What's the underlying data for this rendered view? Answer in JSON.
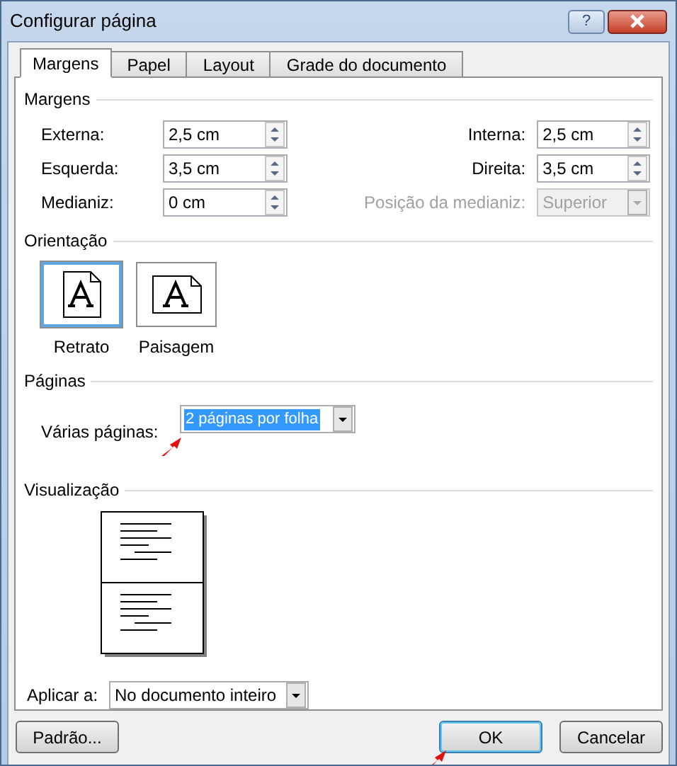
{
  "window": {
    "title": "Configurar página",
    "help": "?"
  },
  "tabs": [
    {
      "label": "Margens",
      "selected": true
    },
    {
      "label": "Papel",
      "selected": false
    },
    {
      "label": "Layout",
      "selected": false
    },
    {
      "label": "Grade do documento",
      "selected": false
    }
  ],
  "margins": {
    "heading": "Margens",
    "fields": [
      {
        "label": "Externa:",
        "value": "2,5 cm",
        "kind": "spin",
        "disabled": false
      },
      {
        "label": "Interna:",
        "value": "2,5 cm",
        "kind": "spin",
        "disabled": false
      },
      {
        "label": "Esquerda:",
        "value": "3,5 cm",
        "kind": "spin",
        "disabled": false
      },
      {
        "label": "Direita:",
        "value": "3,5 cm",
        "kind": "spin",
        "disabled": false
      },
      {
        "label": "Medianiz:",
        "value": "0 cm",
        "kind": "spin",
        "disabled": false
      },
      {
        "label": "Posição da medianiz:",
        "value": "Superior",
        "kind": "dropdown",
        "disabled": true
      }
    ]
  },
  "orientation": {
    "heading": "Orientação",
    "options": [
      {
        "label": "Retrato",
        "kind": "portrait",
        "selected": true
      },
      {
        "label": "Paisagem",
        "kind": "landscape",
        "selected": false
      }
    ]
  },
  "pages": {
    "heading": "Páginas",
    "label": "Várias páginas:",
    "value": "2 páginas por folha",
    "focused": true
  },
  "preview": {
    "heading": "Visualização"
  },
  "apply_to": {
    "label": "Aplicar a:",
    "value": "No documento inteiro"
  },
  "buttons": [
    {
      "label": "Padrão...",
      "default": false
    },
    {
      "label": "OK",
      "default": true
    },
    {
      "label": "Cancelar",
      "default": false
    }
  ]
}
